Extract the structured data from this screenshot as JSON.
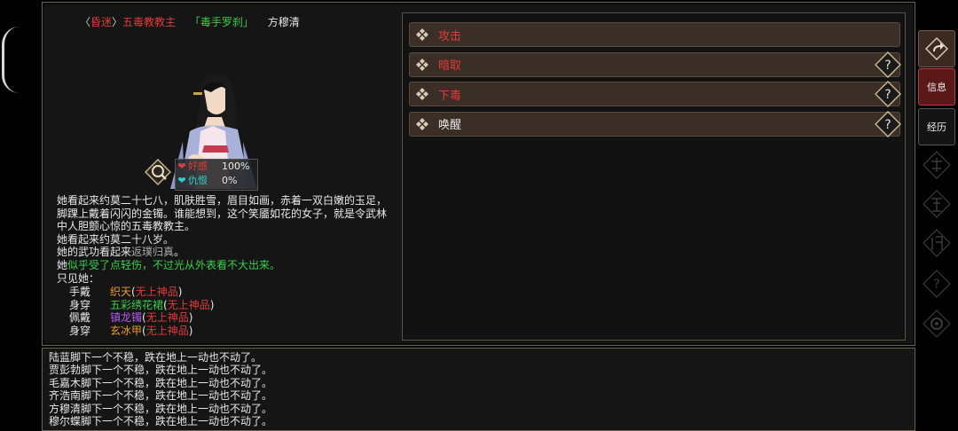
{
  "character": {
    "faction_prefix": "〈",
    "faction_tag": "昏迷",
    "faction_sep": "〉",
    "faction": "五毒教教主",
    "title": "「毒手罗刹」",
    "name": "方穆清"
  },
  "status": {
    "favor_label": "好感",
    "favor_value": "100%",
    "hatred_label": "仇恨",
    "hatred_value": "0%"
  },
  "description": {
    "para1": "她看起来约莫二十七八，肌肤胜雪，眉目如画，赤着一双白嫩的玉足，脚踝上戴着闪闪的金镯。谁能想到，这个笑靥如花的女子，就是令武林中人胆颤心惊的五毒教教主。",
    "age_line": "她看起来约莫二十八岁。",
    "martial_prefix": "她的武功看起来",
    "martial_level": "返璞归真",
    "martial_suffix": "。",
    "injury_prefix": "她",
    "injury_text": "似乎受了点轻伤，不过光从外表看不大出来。",
    "equip_intro": "只见她："
  },
  "equipment": [
    {
      "slot": "手戴",
      "item": "织天",
      "grade": "无上神品",
      "item_color": "#e89b2a"
    },
    {
      "slot": "身穿",
      "item": "五彩绣花裙",
      "grade": "无上神品",
      "item_color": "#38d04a"
    },
    {
      "slot": "佩戴",
      "item": "镇龙镯",
      "grade": "无上神品",
      "item_color": "#b45cf2"
    },
    {
      "slot": "身穿",
      "item": "玄冰甲",
      "grade": "无上神品",
      "item_color": "#e89b2a"
    }
  ],
  "equip_paren_open": "(",
  "equip_paren_close": ")",
  "actions": [
    {
      "label": "攻击",
      "color": "#e23b3b",
      "has_help": false
    },
    {
      "label": "暗取",
      "color": "#e23b3b",
      "has_help": true
    },
    {
      "label": "下毒",
      "color": "#e23b3b",
      "has_help": true
    },
    {
      "label": "唤醒",
      "color": "#e8e8e8",
      "has_help": true
    }
  ],
  "sidebar": {
    "info_label": "信息",
    "history_label": "经历"
  },
  "log": [
    "陆蓝脚下一个不稳，跌在地上一动也不动了。",
    "贾彭勃脚下一个不稳，跌在地上一动也不动了。",
    "毛嘉木脚下一个不稳，跌在地上一动也不动了。",
    "齐浩南脚下一个不稳，跌在地上一动也不动了。",
    "方穆清脚下一个不稳，跌在地上一动也不动了。",
    "穆尔蝶脚下一个不稳，跌在地上一动也不动了。"
  ]
}
